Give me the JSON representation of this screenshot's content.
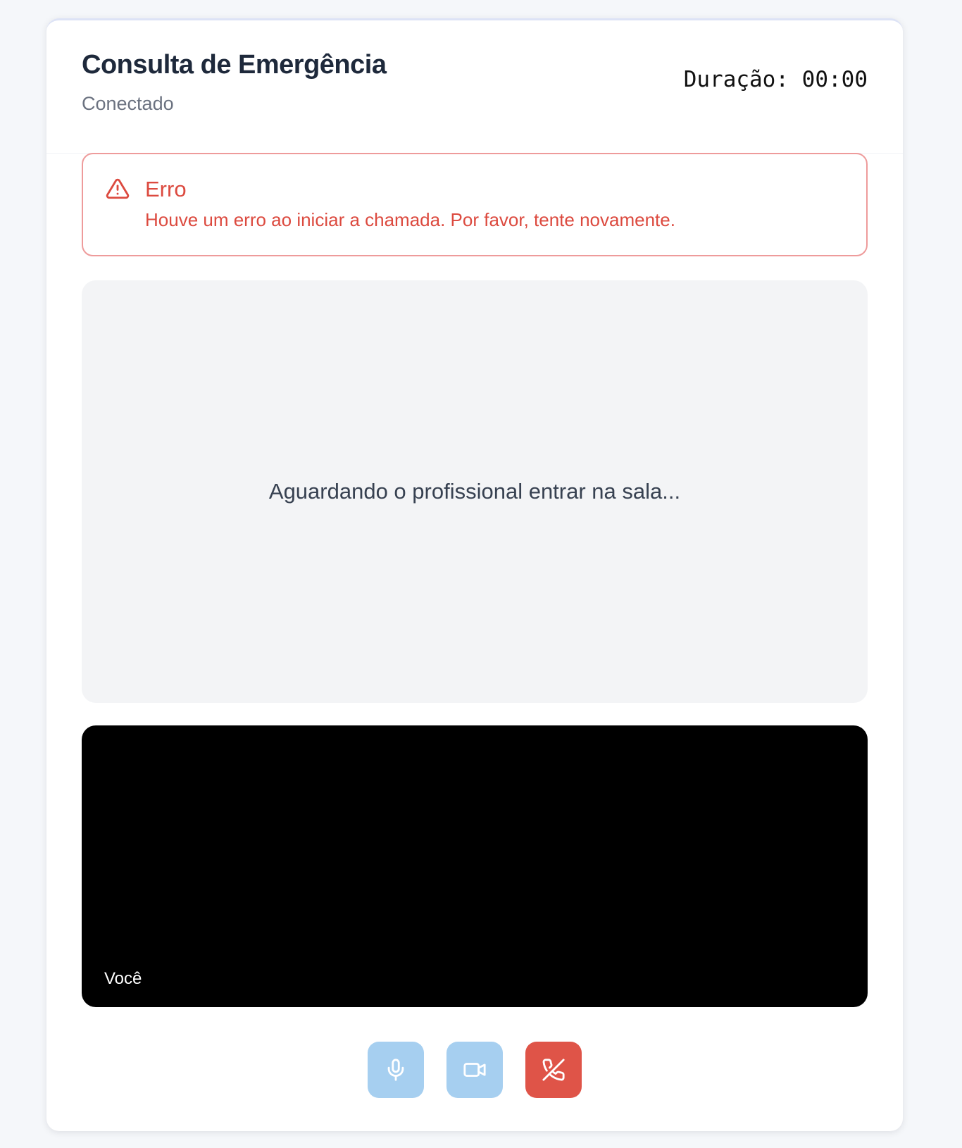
{
  "header": {
    "title": "Consulta de Emergência",
    "status": "Conectado",
    "duration": "Duração: 00:00"
  },
  "error": {
    "icon": "warning-icon",
    "title": "Erro",
    "message": "Houve um erro ao iniciar a chamada. Por favor, tente novamente.",
    "color": "#dc4a3f",
    "border_color": "#ee9b9b"
  },
  "remote_video": {
    "waiting_text": "Aguardando o profissional entrar na sala..."
  },
  "local_video": {
    "label": "Você"
  },
  "controls": [
    {
      "name": "mute-microphone-button",
      "icon": "microphone-icon",
      "color": "#a6cff0"
    },
    {
      "name": "toggle-camera-button",
      "icon": "video-camera-icon",
      "color": "#a6cff0"
    },
    {
      "name": "end-call-button",
      "icon": "phone-off-icon",
      "color": "#df5448"
    }
  ]
}
